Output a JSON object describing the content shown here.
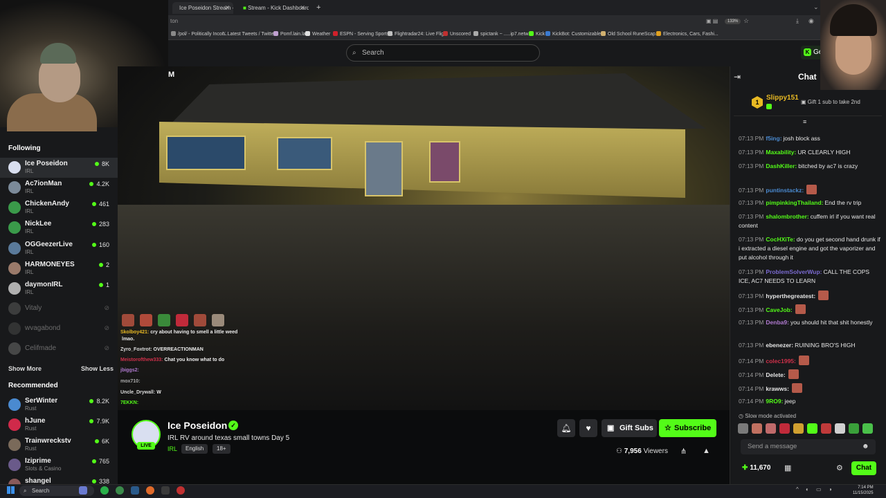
{
  "browser": {
    "tabs": [
      {
        "label": "Ice Poseidon Stream - Wat"
      },
      {
        "label": "Stream - Kick Dashboard"
      }
    ],
    "new_tab_symbol": "+",
    "url_fragment": "ton",
    "zoom": "133%",
    "bookmarks": [
      "/pol/ - Politically Incor...",
      "Latest Tweets / Twitter",
      "Pomf.lain.la",
      "Weather",
      "ESPN - Serving Sports...",
      "Flightradar24: Live Flig...",
      "Unscored",
      "spictank ~ .....ip7.netw...",
      "Kick",
      "KickBot: Customizable...",
      "Old School RuneScap...",
      "Electronics, Cars, Fashi..."
    ]
  },
  "topbar": {
    "search_placeholder": "Search",
    "get_label": "Get"
  },
  "video_label": "M",
  "sidebar": {
    "following_title": "Following",
    "following": [
      {
        "name": "Ice Poseidon",
        "category": "IRL",
        "viewers": "8K",
        "color": "#d9dff0",
        "active": true
      },
      {
        "name": "Ac7ionMan",
        "category": "IRL",
        "viewers": "4.2K",
        "color": "#7b8a99"
      },
      {
        "name": "ChickenAndy",
        "category": "IRL",
        "viewers": "461",
        "color": "#3a9a4a"
      },
      {
        "name": "NickLee",
        "category": "IRL",
        "viewers": "283",
        "color": "#3a9a4a"
      },
      {
        "name": "OGGeezerLive",
        "category": "IRL",
        "viewers": "160",
        "color": "#5a7a9a"
      },
      {
        "name": "HARMONEYES",
        "category": "IRL",
        "viewers": "2",
        "color": "#9a7a6a"
      },
      {
        "name": "daymonIRL",
        "category": "IRL",
        "viewers": "1",
        "color": "#b0b0b0"
      }
    ],
    "offline": [
      {
        "name": "Vitaly",
        "color": "#555"
      },
      {
        "name": "wvagabond",
        "color": "#444"
      },
      {
        "name": "Celifmade",
        "color": "#666"
      }
    ],
    "show_more": "Show More",
    "show_less": "Show Less",
    "recommended_title": "Recommended",
    "recommended": [
      {
        "name": "SerWinter",
        "category": "Rust",
        "viewers": "8.2K",
        "color": "#4a8ad0"
      },
      {
        "name": "hJune",
        "category": "Rust",
        "viewers": "7.9K",
        "color": "#d02a4a"
      },
      {
        "name": "Trainwreckstv",
        "category": "Rust",
        "viewers": "6K",
        "color": "#7a6a5a"
      },
      {
        "name": "Iziprime",
        "category": "Slots & Casino",
        "viewers": "765",
        "color": "#6a5a8a"
      },
      {
        "name": "shangel",
        "category": "",
        "viewers": "338",
        "color": "#8a5a5a"
      }
    ]
  },
  "overlay_chat": [
    {
      "user": "Skolboy421:",
      "text": "cry about having to smell a little weed",
      "color": "#e8b923"
    },
    {
      "user": "",
      "text": "lmao.",
      "color": "#e8b923"
    },
    {
      "user": "Zyro_Foxtrot:",
      "text": "OVERREACTIONMAN",
      "color": "#dddddd"
    },
    {
      "user": "Meistorofthew333:",
      "text": "Chat you know what to do",
      "color": "#d0304a"
    },
    {
      "user": "jbiggs2:",
      "text": "",
      "color": "#b07ad0"
    },
    {
      "user": "mox710:",
      "text": "",
      "color": "#aaaaaa"
    },
    {
      "user": "Uncle_Drywall:",
      "text": "W",
      "color": "#dddddd"
    },
    {
      "user": "7EKKN:",
      "text": "",
      "color": "#53fc18"
    }
  ],
  "stream": {
    "live_badge": "LIVE",
    "name": "Ice Poseidon",
    "verified_mark": "✓",
    "title": "IRL RV around texas small towns Day 5",
    "category": "IRL",
    "tags": [
      "English",
      "18+"
    ],
    "gift_label": "Gift Subs",
    "subscribe_label": "Subscribe",
    "viewer_count": "7,956",
    "viewers_label": "Viewers"
  },
  "chat": {
    "title": "Chat",
    "pinned": {
      "rank": "1",
      "user": "Slippy151",
      "gift_text": "Gift 1 sub to take 2nd"
    },
    "messages": [
      {
        "time": "07:13 PM",
        "user": "f5ing:",
        "text": "josh block ass",
        "color": "#4a8ad0"
      },
      {
        "time": "07:13 PM",
        "user": "Maxability:",
        "text": "UR CLEARLY HIGH",
        "color": "#53fc18"
      },
      {
        "time": "07:13 PM",
        "user": "DashKiller:",
        "text": "bitched by ac7 is crazy",
        "color": "#53fc18"
      },
      {
        "time": "07:13 PM",
        "user": "puntinstackz:",
        "text": "",
        "color": "#4a8ad0"
      },
      {
        "time": "07:13 PM",
        "user": "pimpinkingThailand:",
        "text": "End the rv trip",
        "color": "#53fc18"
      },
      {
        "time": "07:13 PM",
        "user": "shalombrother:",
        "text": "cuffem irl if you want real content",
        "color": "#53fc18"
      },
      {
        "time": "07:13 PM",
        "user": "CocHXiTe:",
        "text": "do you get second hand drunk if i extracted a diesel engine and got the vaporizer and put alcohol through it",
        "color": "#53fc18"
      },
      {
        "time": "07:13 PM",
        "user": "ProblemSolverWup:",
        "text": "CALL THE COPS ICE, AC7 NEEDS TO LEARN",
        "color": "#7a6ad0"
      },
      {
        "time": "07:13 PM",
        "user": "hyperthegreatest:",
        "text": "",
        "color": "#e6e6e6"
      },
      {
        "time": "07:13 PM",
        "user": "CaveJob:",
        "text": "",
        "color": "#53fc18"
      },
      {
        "time": "07:13 PM",
        "user": "Denba9:",
        "text": "you should hit that shit honestly",
        "color": "#b07ad0"
      },
      {
        "time": "07:13 PM",
        "user": "ebenezer:",
        "text": "RUINING BRO'S HIGH",
        "color": "#e6e6e6"
      },
      {
        "time": "07:14 PM",
        "user": "colec1995:",
        "text": "",
        "color": "#d0304a"
      },
      {
        "time": "07:14 PM",
        "user": "Delete:",
        "text": "",
        "color": "#e6e6e6"
      },
      {
        "time": "07:14 PM",
        "user": "krawws:",
        "text": "",
        "color": "#e6e6e6"
      },
      {
        "time": "07:14 PM",
        "user": "9RO9:",
        "text": "jeep",
        "color": "#53fc18"
      }
    ],
    "slow_mode": "Slow mode activated",
    "input_placeholder": "Send a message",
    "points": "11,670",
    "send_label": "Chat"
  },
  "taskbar": {
    "search_label": "Search",
    "time": "7:14 PM",
    "date": "11/15/2025"
  },
  "colors": {
    "accent": "#53fc18",
    "bg": "#0b0c0d",
    "panel": "#18191b"
  }
}
